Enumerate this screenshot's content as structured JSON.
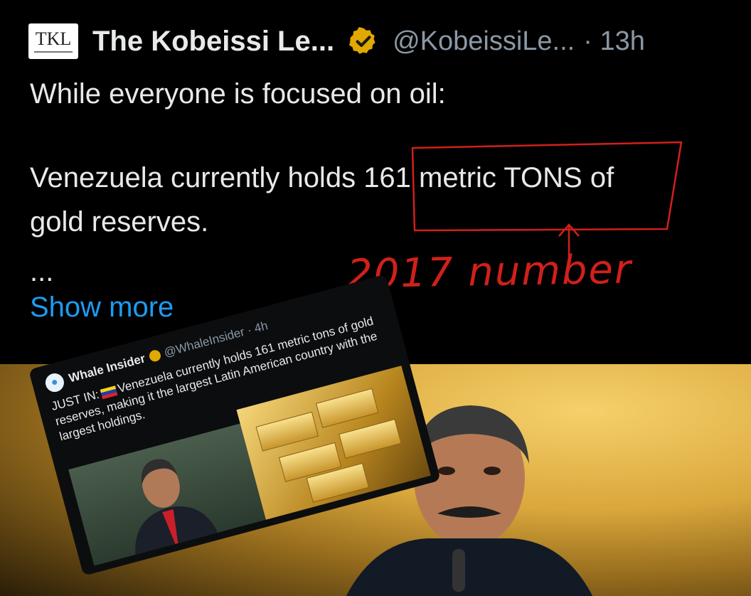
{
  "tweet": {
    "avatar_text": "TKL",
    "author_name": "The Kobeissi Le...",
    "verified_icon": "gold-checkmark-badge-icon",
    "handle": "@KobeissiLe...",
    "time": "· 13h",
    "line1": "While everyone is focused on oil:",
    "line2_before": "Venezuela currently holds ",
    "line2_boxed": "161 metric TONS",
    "line2_after": " of",
    "line3": "gold reserves.",
    "ellipsis": "...",
    "show_more": "Show more"
  },
  "annotation": {
    "text": "2017 number",
    "color": "#d1201a"
  },
  "embedded_tweet": {
    "avatar_icon": "whale-icon",
    "author_name": "Whale Insider",
    "handle": "@WhaleInsider · 4h",
    "just_in": "JUST IN:",
    "flag_icon": "venezuela-flag-icon",
    "text": "Venezuela currently holds 161 metric tons of gold reserves, making it the largest Latin American country with the largest holdings."
  },
  "colors": {
    "background": "#000000",
    "text": "#e7e9ea",
    "muted": "#8b98a5",
    "link": "#1d9bf0",
    "badge": "#e0a800"
  }
}
